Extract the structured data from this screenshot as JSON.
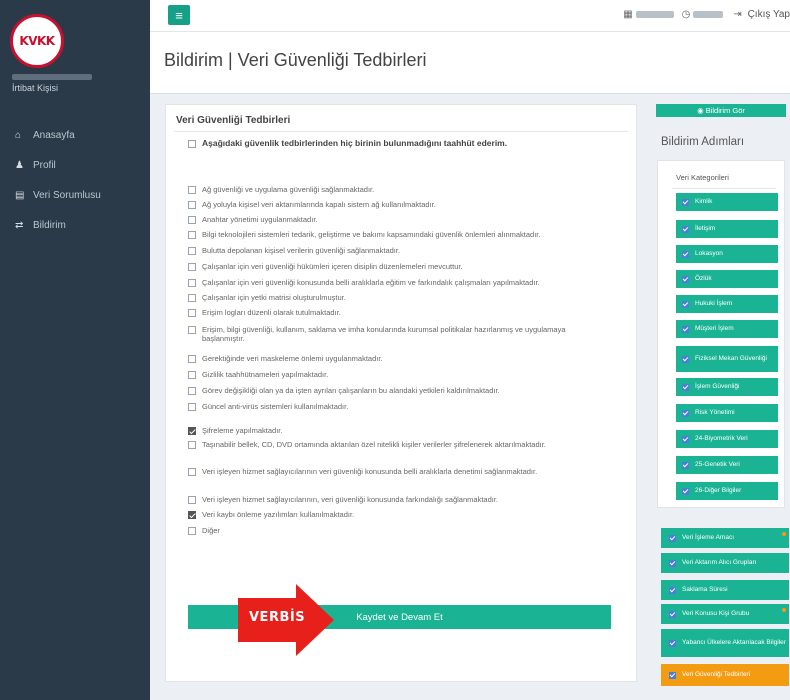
{
  "sidebar": {
    "logo_text": "KVKK",
    "user_role": "İrtibat Kişisi",
    "menu": [
      {
        "icon": "home-icon",
        "glyph": "⌂",
        "label": "Anasayfa"
      },
      {
        "icon": "user-icon",
        "glyph": "♟",
        "label": "Profil"
      },
      {
        "icon": "building-icon",
        "glyph": "▤",
        "label": "Veri Sorumlusu"
      },
      {
        "icon": "notification-icon",
        "glyph": "⇄",
        "label": "Bildirim"
      }
    ]
  },
  "topbar": {
    "menu_icon": "≡",
    "logout_label": "Çıkış Yap"
  },
  "page": {
    "title": "Bildirim | Veri Güvenliği Tedbirleri"
  },
  "form": {
    "title": "Veri Güvenliği Tedbirleri",
    "no_measure": {
      "label": "Aşağıdaki güvenlik tedbirlerinden hiç birinin bulunmadığını taahhüt ederim.",
      "checked": false
    },
    "items": [
      {
        "label": "Ağ güvenliği ve uygulama güvenliği sağlanmaktadır.",
        "checked": false
      },
      {
        "label": "Ağ yoluyla kişisel veri aktarımlarında kapalı sistem ağ kullanılmaktadır.",
        "checked": false
      },
      {
        "label": "Anahtar yönetimi uygulanmaktadır.",
        "checked": false
      },
      {
        "label": "Bilgi teknolojileri sistemleri tedarik, geliştirme ve bakımı kapsamındaki güvenlik önlemleri alınmaktadır.",
        "checked": false
      },
      {
        "label": "Bulutta depolanan kişisel verilerin güvenliği sağlanmaktadır.",
        "checked": false
      },
      {
        "label": "Çalışanlar için veri güvenliği hükümleri içeren disiplin düzenlemeleri mevcuttur.",
        "checked": false
      },
      {
        "label": "Çalışanlar için veri güvenliği konusunda belli aralıklarla eğitim ve farkındalık çalışmaları yapılmaktadır.",
        "checked": false
      },
      {
        "label": "Çalışanlar için yetki matrisi oluşturulmuştur.",
        "checked": false
      },
      {
        "label": "Erişim logları düzenli olarak tutulmaktadır.",
        "checked": false
      },
      {
        "label": "Erişim, bilgi güvenliği, kullanım, saklama ve imha konularında kurumsal politikalar hazırlanmış ve uygulamaya başlanmıştır.",
        "checked": false
      },
      {
        "label": "Gerektiğinde veri maskeleme önlemi uygulanmaktadır.",
        "checked": false
      },
      {
        "label": "Gizlilik taahhütnameleri yapılmaktadır.",
        "checked": false
      },
      {
        "label": "Görev değişikliği olan ya da işten ayrılan çalışanların bu alandaki yetkileri kaldırılmaktadır.",
        "checked": false
      },
      {
        "label": "Güncel anti-virüs sistemleri kullanılmaktadır.",
        "checked": false
      },
      {
        "label": "Şifreleme yapılmaktadır.",
        "checked": true
      },
      {
        "label": "Taşınabilir bellek, CD, DVD ortamında aktarılan özel nitelikli kişiler verilerler şifrelenerek aktarılmaktadır.",
        "checked": false
      },
      {
        "label": "Veri işleyen hizmet sağlayıcılarının veri güvenliği konusunda belli aralıklarla denetimi sağlanmaktadır.",
        "checked": false
      },
      {
        "label": "Veri işleyen hizmet sağlayıcılarının, veri güvenliği konusunda farkındalığı sağlanmaktadır.",
        "checked": false
      },
      {
        "label": "Veri kaybı önleme yazılımları kullanılmaktadır.",
        "checked": true
      },
      {
        "label": "Diğer",
        "checked": false
      }
    ],
    "save_label": "Kaydet ve Devam Et"
  },
  "overlay": {
    "label": "VERBİS",
    "color": "#e8201c"
  },
  "right_panel": {
    "show_button": "◉ Bildirim Gör",
    "steps_title": "Bildirim Adımları",
    "categories_title": "Veri Kategorileri",
    "categories": [
      "Kimlik",
      "İletişim",
      "Lokasyon",
      "Özlük",
      "Hukuki İşlem",
      "Müşteri İşlem",
      "Fiziksel Mekan Güvenliği",
      "İşlem Güvenliği",
      "Risk Yönetimi",
      "24-Biyometrik Veri",
      "25-Genetik Veri",
      "26-Diğer Bilgiler"
    ],
    "steps": [
      {
        "label": "Veri İşleme Amacı",
        "active": false,
        "dot": true
      },
      {
        "label": "Veri Aktarım Alıcı Grupları",
        "active": false,
        "dot": false
      },
      {
        "label": "Saklama Süresi",
        "active": false,
        "dot": false
      },
      {
        "label": "Veri Konusu Kişi Grubu",
        "active": false,
        "dot": true
      },
      {
        "label": "Yabancı Ülkelere Aktarılacak Bilgiler",
        "active": false,
        "dot": false
      },
      {
        "label": "Veri Güvenliği Tedbirleri",
        "active": true,
        "dot": false
      }
    ],
    "colors": {
      "step": "#1ab394",
      "active_step": "#f39c12",
      "tick": "#4a7ed8"
    }
  }
}
